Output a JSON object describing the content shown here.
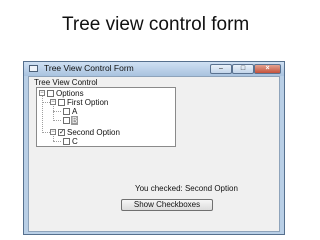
{
  "slide": {
    "title": "Tree view control form"
  },
  "window": {
    "title": "Tree View Control Form",
    "buttons": {
      "minimize": "–",
      "maximize": "□",
      "close": "×"
    }
  },
  "group": {
    "label": "Tree View Control"
  },
  "tree": {
    "nodes": [
      {
        "label": "Options",
        "checked": false,
        "expanded": true
      },
      {
        "label": "First Option",
        "checked": false,
        "expanded": true
      },
      {
        "label": "A",
        "checked": false
      },
      {
        "label": "B",
        "checked": false,
        "selected": true
      },
      {
        "label": "Second Option",
        "checked": true,
        "expanded": true
      },
      {
        "label": "C",
        "checked": false
      }
    ]
  },
  "status": {
    "text": "You checked: Second Option"
  },
  "button": {
    "label": "Show Checkboxes"
  }
}
